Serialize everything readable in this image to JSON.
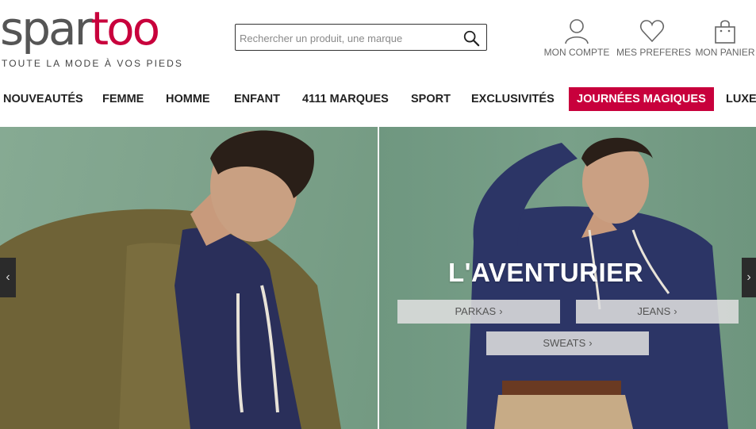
{
  "brand": {
    "logo_part1": "spar",
    "logo_part2": "too",
    "tagline": "TOUTE LA MODE À VOS PIEDS",
    "accent_color": "#c8003c"
  },
  "search": {
    "placeholder": "Rechercher un produit, une marque",
    "icon": "search-icon"
  },
  "account": {
    "items": [
      {
        "label": "MON COMPTE",
        "icon": "user-icon"
      },
      {
        "label": "MES PREFERES",
        "icon": "heart-icon"
      },
      {
        "label": "MON PANIER",
        "icon": "shopping-bag-icon"
      }
    ]
  },
  "nav": {
    "items": [
      {
        "label": "NOUVEAUTÉS"
      },
      {
        "label": "FEMME"
      },
      {
        "label": "HOMME"
      },
      {
        "label": "ENFANT"
      },
      {
        "label": "4111 MARQUES"
      },
      {
        "label": "SPORT"
      },
      {
        "label": "EXCLUSIVITÉS"
      },
      {
        "label": "JOURNÉES MAGIQUES",
        "highlight": true
      },
      {
        "label": "LUXE"
      }
    ]
  },
  "hero": {
    "title": "L'AVENTURIER",
    "buttons": [
      {
        "label": "PARKAS",
        "chevron": "›"
      },
      {
        "label": "JEANS",
        "chevron": "›"
      },
      {
        "label": "SWEATS",
        "chevron": "›"
      }
    ],
    "prev_arrow": "‹",
    "next_arrow": "›"
  }
}
